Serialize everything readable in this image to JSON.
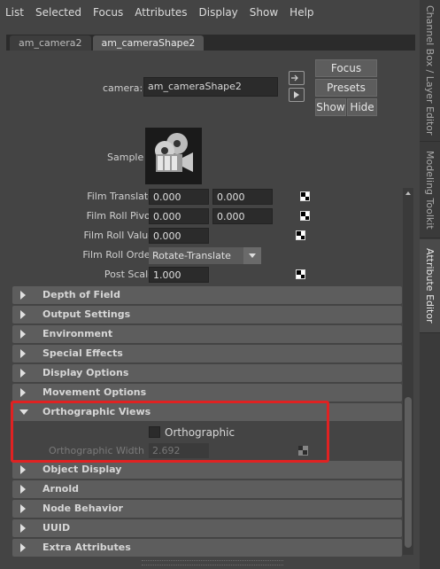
{
  "menu": [
    "List",
    "Selected",
    "Focus",
    "Attributes",
    "Display",
    "Show",
    "Help"
  ],
  "tabs": [
    {
      "label": "am_camera2",
      "active": false
    },
    {
      "label": "am_cameraShape2",
      "active": true
    }
  ],
  "camera": {
    "label": "camera:",
    "value": "am_cameraShape2"
  },
  "buttons": {
    "focus": "Focus",
    "presets": "Presets",
    "show": "Show",
    "hide": "Hide"
  },
  "sample": {
    "label": "Sample"
  },
  "film": {
    "translate": {
      "label": "Film Translate",
      "v1": "0.000",
      "v2": "0.000"
    },
    "roll_pivot": {
      "label": "Film Roll Pivot",
      "v1": "0.000",
      "v2": "0.000"
    },
    "roll_value": {
      "label": "Film Roll Value",
      "v1": "0.000"
    },
    "roll_order": {
      "label": "Film Roll Order",
      "value": "Rotate-Translate"
    },
    "post_scale": {
      "label": "Post Scale",
      "v1": "1.000"
    }
  },
  "sections": [
    "Depth of Field",
    "Output Settings",
    "Environment",
    "Special Effects",
    "Display Options",
    "Movement Options",
    "Orthographic Views",
    "Object Display",
    "Arnold",
    "Node Behavior",
    "UUID",
    "Extra Attributes"
  ],
  "ortho": {
    "checkbox_label": "Orthographic",
    "checked": false,
    "width_label": "Orthographic Width",
    "width_value": "2.692"
  },
  "side_tabs": [
    "Channel Box / Layer Editor",
    "Modeling Toolkit",
    "Attribute Editor"
  ],
  "colors": {
    "highlight": "#e02222",
    "panel": "#444444",
    "section": "#5d5d5d"
  }
}
